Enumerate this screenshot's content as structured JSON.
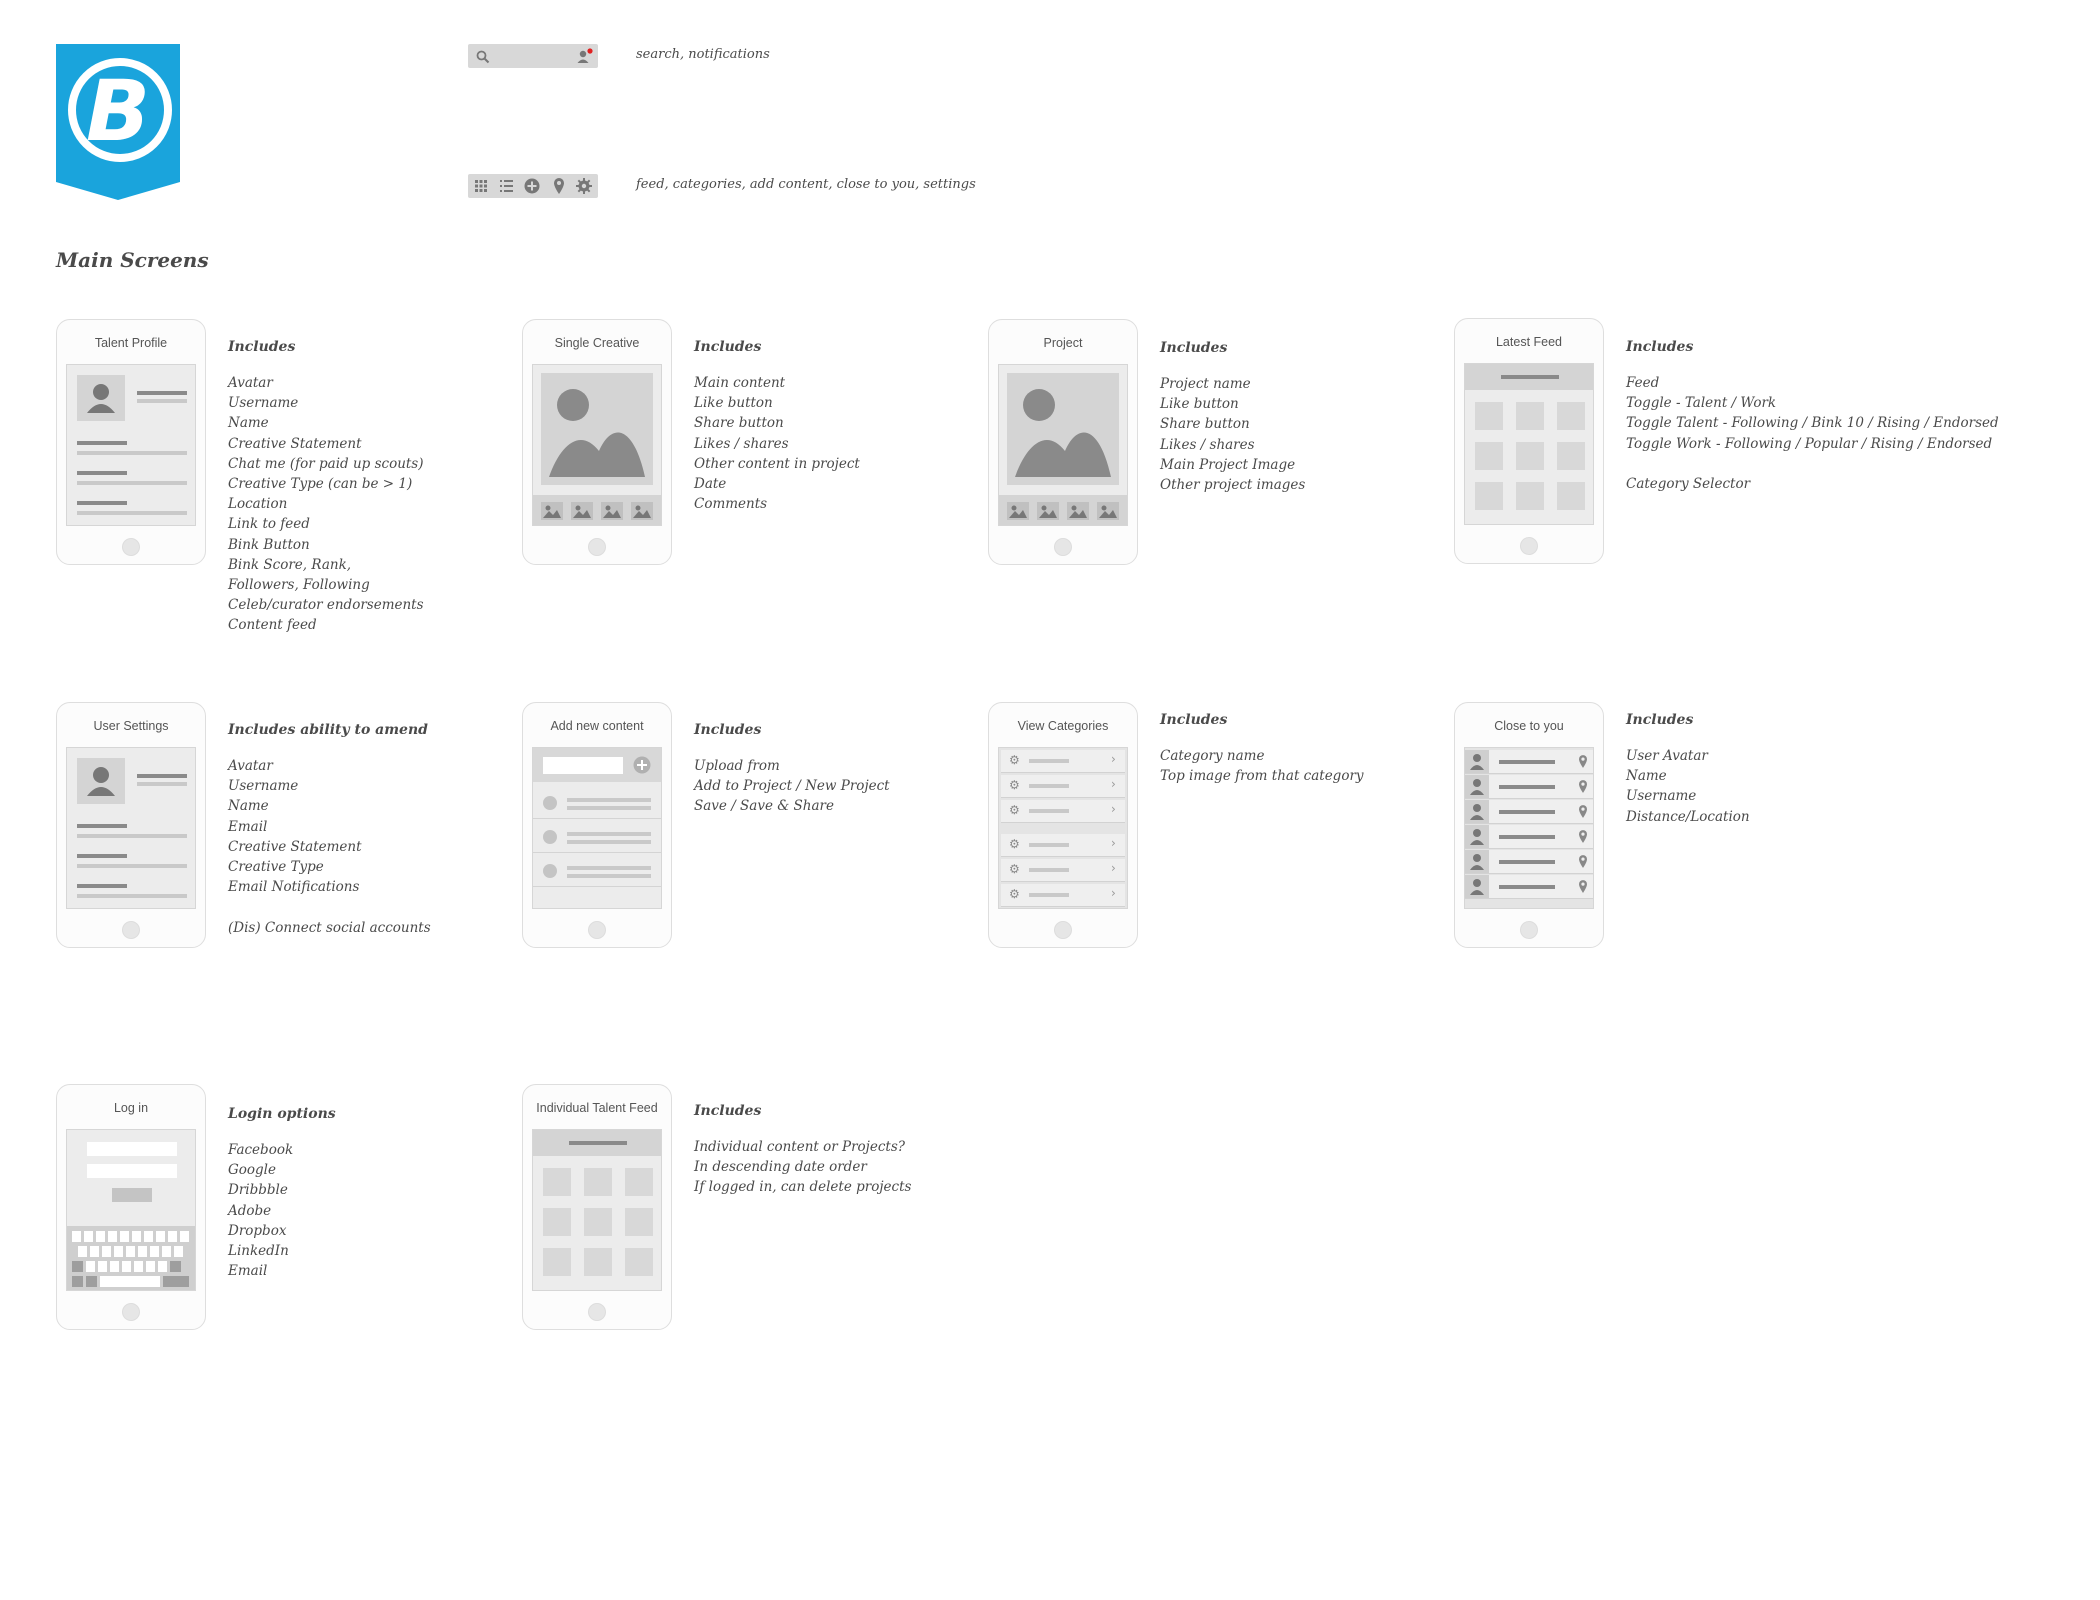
{
  "header": {
    "logo_letter": "B",
    "logo_color": "#1aa4dc",
    "top_bar_note": "search, notifications",
    "bottom_bar_note": "feed, categories, add content, close to you, settings",
    "top_bar_icons": [
      "search-icon",
      "user-notification-icon"
    ],
    "bottom_bar_icons": [
      "grid-icon",
      "list-icon",
      "add-icon",
      "location-pin-icon",
      "gear-icon"
    ]
  },
  "section_title": "Main Screens",
  "screens": [
    {
      "title": "Talent Profile",
      "heading": "Includes",
      "items": [
        "Avatar",
        "Username",
        "Name",
        "Creative Statement",
        "Chat me (for paid up scouts)",
        "Creative Type (can be > 1)",
        "Location",
        "Link to feed",
        "Bink Button",
        "Bink Score, Rank,",
        "Followers, Following",
        "Celeb/curator endorsements",
        "Content feed"
      ]
    },
    {
      "title": "Single Creative",
      "heading": "Includes",
      "items": [
        "Main content",
        "Like button",
        "Share button",
        "Likes / shares",
        "Other content in project",
        "Date",
        "Comments"
      ]
    },
    {
      "title": "Project",
      "heading": "Includes",
      "items": [
        "Project name",
        "Like button",
        "Share button",
        "Likes / shares",
        "Main Project Image",
        "Other project images"
      ]
    },
    {
      "title": "Latest Feed",
      "heading": "Includes",
      "items": [
        "Feed",
        "Toggle - Talent / Work",
        "Toggle Talent - Following / Bink 10 / Rising / Endorsed",
        "Toggle Work - Following / Popular / Rising / Endorsed",
        "",
        "Category Selector"
      ]
    },
    {
      "title": "User Settings",
      "heading": "Includes ability to amend",
      "items": [
        "Avatar",
        "Username",
        "Name",
        "Email",
        "Creative Statement",
        "Creative Type",
        "Email Notifications",
        "",
        "(Dis) Connect social accounts"
      ]
    },
    {
      "title": "Add new content",
      "heading": "Includes",
      "items": [
        "Upload from",
        "Add to Project / New Project",
        "Save / Save & Share"
      ]
    },
    {
      "title": "View Categories",
      "heading": "Includes",
      "items": [
        "Category name",
        "Top image from that category"
      ]
    },
    {
      "title": "Close to you",
      "heading": "Includes",
      "items": [
        "User Avatar",
        "Name",
        "Username",
        "Distance/Location"
      ]
    },
    {
      "title": "Log in",
      "heading": "Login options",
      "items": [
        "Facebook",
        "Google",
        "Dribbble",
        "Adobe",
        "Dropbox",
        "LinkedIn",
        "Email"
      ]
    },
    {
      "title": "Individual Talent Feed",
      "heading": "Includes",
      "items": [
        "Individual content or Projects?",
        "In descending date order",
        "If logged in, can delete projects"
      ]
    }
  ]
}
